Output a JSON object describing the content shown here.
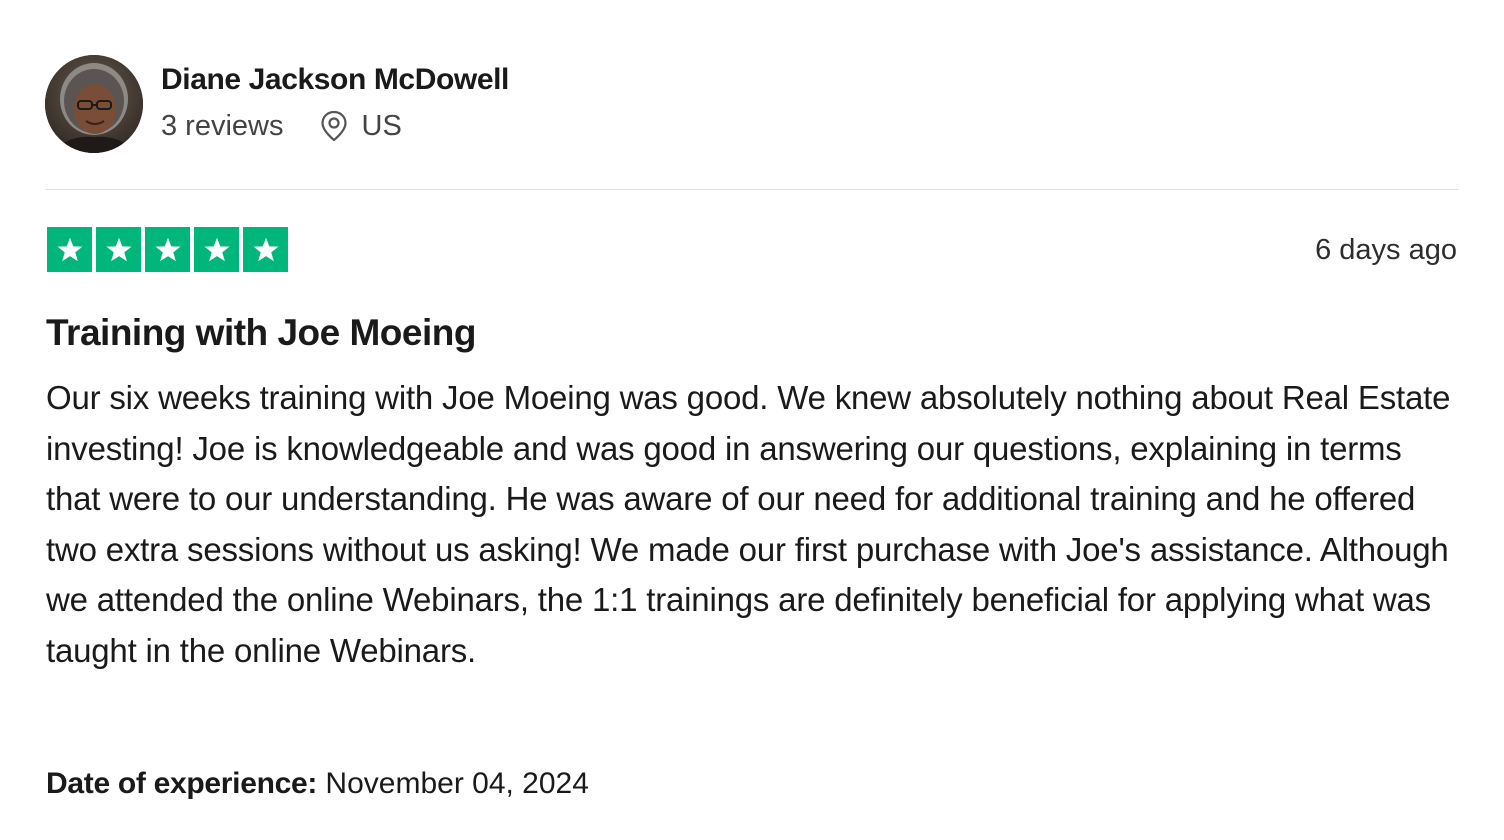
{
  "reviewer": {
    "name": "Diane Jackson McDowell",
    "reviews_count": "3 reviews",
    "country": "US",
    "avatar_icon": "user-avatar-photo",
    "location_icon": "location-pin-icon"
  },
  "rating": {
    "stars": 5,
    "max_stars": 5,
    "star_color": "#00b67a",
    "star_icon": "star-icon"
  },
  "review": {
    "date": "6 days ago",
    "title": "Training with Joe Moeing",
    "body": "Our six weeks training with Joe Moeing was good. We knew absolutely nothing about Real Estate investing! Joe is knowledgeable and was good in answering our questions, explaining in terms that were to our understanding. He was aware of our need for additional training and he offered two extra sessions without us asking! We made our first purchase with Joe's assistance. Although we attended the online Webinars, the 1:1 trainings are definitely beneficial for applying what was taught in the online Webinars.",
    "experience_label": "Date of experience:",
    "experience_date": "November 04, 2024"
  }
}
